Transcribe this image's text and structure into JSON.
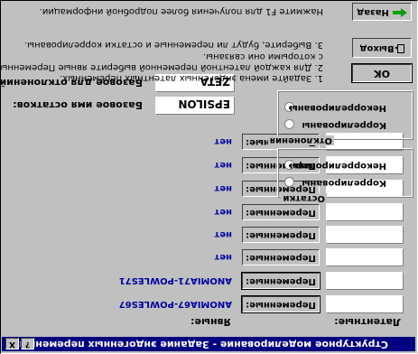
{
  "window": {
    "title": "Структурное моделирование - Задание эндогенных переменных",
    "help_glyph": "?",
    "close_glyph": "X"
  },
  "labels": {
    "latent_header": "Латентные:",
    "manifest_header": "Явные:",
    "base_error_name": "Базовое имя остатков:",
    "base_deviation_name": "Базовое для отклонений:"
  },
  "fields": {
    "base_error_value": "EPSILON",
    "base_deviation_value": "ZETA"
  },
  "rows": [
    {
      "latent": "",
      "button": "Переменные:",
      "assigned": "ANOMIA67-POWLES67"
    },
    {
      "latent": "",
      "button": "Переменные:",
      "assigned": "ANOMIA71-POWLES71"
    },
    {
      "latent": "",
      "button": "Переменные:",
      "assigned": "нет"
    },
    {
      "latent": "",
      "button": "Переменные:",
      "assigned": "нет"
    },
    {
      "latent": "",
      "button": "Переменные:",
      "assigned": "нет"
    },
    {
      "latent": "",
      "button": "Переменные:",
      "assigned": "нет"
    },
    {
      "latent": "",
      "button": "Переменные:",
      "assigned": "нет"
    },
    {
      "latent": "",
      "button": "Переменные:",
      "assigned": "нет"
    }
  ],
  "groups": {
    "residuals": {
      "caption": "Остатки",
      "options": [
        "Коррелированы",
        "Некоррелированы"
      ],
      "selected": "Некоррелированы"
    },
    "deviations": {
      "caption": "Отклонения",
      "options": [
        "Коррелированы",
        "Некоррелированы"
      ],
      "selected": "Некоррелированы"
    }
  },
  "buttons": {
    "ok": "OK",
    "exit": "Выход",
    "back": "Назад"
  },
  "instructions": [
    "1. Задайте имена эндогенных латентных переменных.",
    "2. Для каждой латентной переменной выберите явные Переменные,",
    "   с которыми они связаны.",
    "3. Выберите, будут ли переменные и остатки коррелированы.",
    "Нажмите F1 для получения более подробной информации."
  ]
}
